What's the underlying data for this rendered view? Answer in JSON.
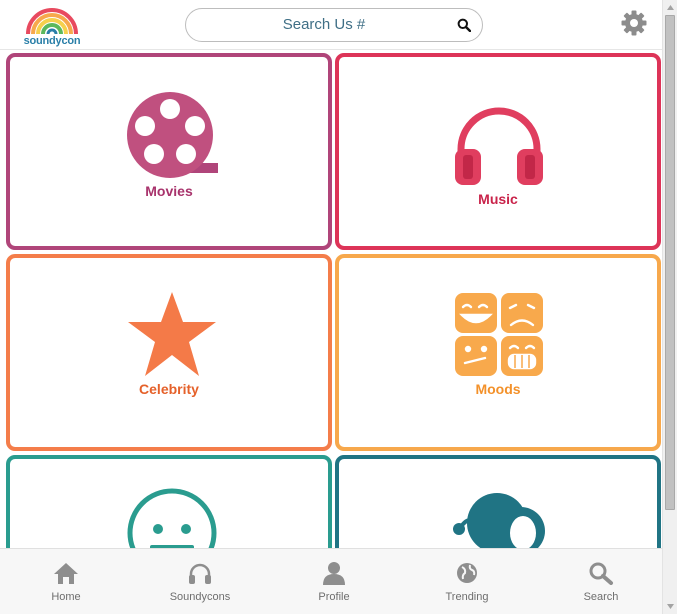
{
  "header": {
    "logo_text": "soundycon",
    "search_placeholder": "Search Us #"
  },
  "icons": {
    "search": "search-icon",
    "settings": "gear-icon"
  },
  "tiles": [
    {
      "label": "Movies",
      "color": "#b0457a",
      "icon": "film-reel-icon"
    },
    {
      "label": "Music",
      "color": "#dd3458",
      "icon": "headphones-icon"
    },
    {
      "label": "Celebrity",
      "color": "#f47d4a",
      "icon": "star-icon"
    },
    {
      "label": "Moods",
      "color": "#f7a84c",
      "icon": "mood-faces-icon"
    },
    {
      "label": "",
      "color": "#2a9c8f",
      "icon": "neutral-face-icon"
    },
    {
      "label": "",
      "color": "#207484",
      "icon": "gadget-icon"
    }
  ],
  "bottom_nav": [
    {
      "label": "Home",
      "icon": "home-icon"
    },
    {
      "label": "Soundycons",
      "icon": "headphones-icon"
    },
    {
      "label": "Profile",
      "icon": "person-icon"
    },
    {
      "label": "Trending",
      "icon": "globe-icon"
    },
    {
      "label": "Search",
      "icon": "search-icon"
    }
  ]
}
